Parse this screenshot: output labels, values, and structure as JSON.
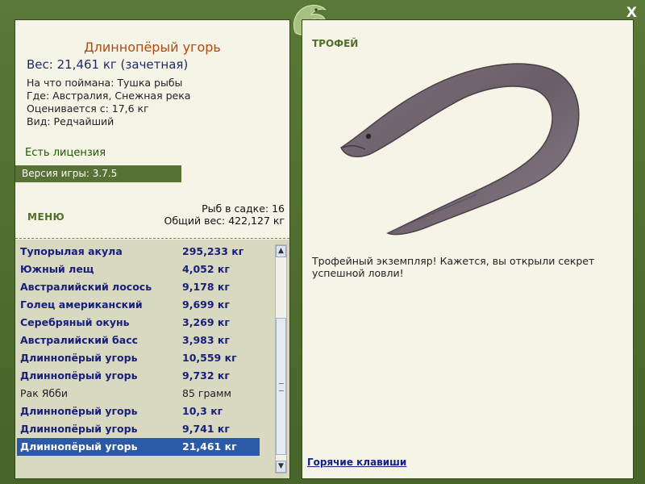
{
  "window": {
    "close_label": "X"
  },
  "fish": {
    "title": "Длиннопёрый угорь",
    "weight_line": "Вес: 21,461 кг (зачетная)",
    "details": [
      "На что поймана: Тушка рыбы",
      "Где: Австралия, Снежная река",
      "Оценивается с: 17,6 кг",
      "Вид: Редчайший"
    ]
  },
  "license_text": "Есть лицензия",
  "version_text": "Версия игры: 3.7.5",
  "menu_label": "МЕНЮ",
  "stats": {
    "fish_in_net": "Рыб в садке: 16",
    "total_weight": "Общий вес: 422,127 кг"
  },
  "catch_list": [
    {
      "name": "Тупорылая акула",
      "weight": "295,233 кг",
      "style": "bold"
    },
    {
      "name": "Южный лещ",
      "weight": "4,052 кг",
      "style": "bold"
    },
    {
      "name": "Австралийский лосось",
      "weight": "9,178 кг",
      "style": "bold"
    },
    {
      "name": "Голец американский",
      "weight": "9,699 кг",
      "style": "bold"
    },
    {
      "name": "Серебряный окунь",
      "weight": "3,269 кг",
      "style": "bold"
    },
    {
      "name": "Австралийский басс",
      "weight": "3,983 кг",
      "style": "bold"
    },
    {
      "name": "Длиннопёрый угорь",
      "weight": "10,559 кг",
      "style": "bold"
    },
    {
      "name": "Длиннопёрый угорь",
      "weight": "9,732 кг",
      "style": "bold"
    },
    {
      "name": "Рак Ябби",
      "weight": "85 грамм",
      "style": "normal"
    },
    {
      "name": "Длиннопёрый угорь",
      "weight": "10,3 кг",
      "style": "bold"
    },
    {
      "name": "Длиннопёрый угорь",
      "weight": "9,741 кг",
      "style": "bold"
    },
    {
      "name": "Длиннопёрый угорь",
      "weight": "21,461 кг",
      "style": "selected"
    }
  ],
  "trophy": {
    "label": "ТРОФЕЙ",
    "description": "Трофейный экземпляр! Кажется, вы открыли секрет успешной ловли!",
    "hotkeys_link": "Горячие клавиши"
  },
  "colors": {
    "frame_green": "#4f6b2f",
    "panel_bg": "#f6f4e6",
    "list_bg": "#d9d8c1",
    "selection": "#2d5aa6",
    "title_orange": "#b04a10",
    "link_blue": "#14208a"
  }
}
